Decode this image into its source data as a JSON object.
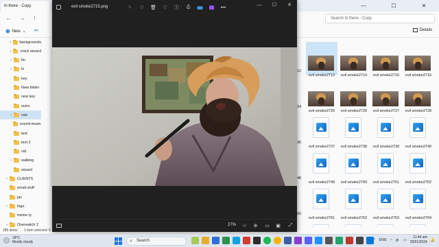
{
  "explorer": {
    "tab_title": "hi there - Copy",
    "window_controls": {
      "minimize": "—",
      "maximize": "☐",
      "close": "✕"
    },
    "search_placeholder": "Search hi there - Copy",
    "new_label": "New",
    "details_label": "Details",
    "sidebar": [
      {
        "label": "backgrounds",
        "chevron": "›"
      },
      {
        "label": "crack wizard",
        "chevron": "›"
      },
      {
        "label": "fin",
        "chevron": "›"
      },
      {
        "label": "fx",
        "chevron": "›"
      },
      {
        "label": "key",
        "chevron": ""
      },
      {
        "label": "New folder",
        "chevron": ""
      },
      {
        "label": "new key",
        "chevron": ""
      },
      {
        "label": "outro",
        "chevron": ""
      },
      {
        "label": "raw",
        "chevron": "›",
        "selected": true
      },
      {
        "label": "sound-music",
        "chevron": ""
      },
      {
        "label": "test",
        "chevron": ""
      },
      {
        "label": "text 2",
        "chevron": ""
      },
      {
        "label": "vid",
        "chevron": ""
      },
      {
        "label": "walking",
        "chevron": "›"
      },
      {
        "label": "wizard",
        "chevron": ""
      },
      {
        "label": "CLIENTS",
        "chevron": "›"
      },
      {
        "label": "email stuff",
        "chevron": ""
      },
      {
        "label": "jaz",
        "chevron": ""
      },
      {
        "label": "logo",
        "chevron": "›"
      },
      {
        "label": "meme ty",
        "chevron": ""
      },
      {
        "label": "Overwatch 2",
        "chevron": "›"
      }
    ],
    "status": {
      "items": "285 items",
      "selected": "1 item selected",
      "extra": "6"
    },
    "partial_numbers": [
      "12",
      "24",
      "36",
      "48",
      "60"
    ],
    "grid": [
      [
        {
          "name": "evil smoke2713",
          "type": "photo",
          "selected": true
        },
        {
          "name": "evil smoke2714",
          "type": "photo"
        },
        {
          "name": "evil smoke2715",
          "type": "photo"
        },
        {
          "name": "evil smoke2716",
          "type": "photo"
        }
      ],
      [
        {
          "name": "evil smoke2725",
          "type": "photo"
        },
        {
          "name": "evil smoke2726",
          "type": "photo"
        },
        {
          "name": "evil smoke2727",
          "type": "photo"
        },
        {
          "name": "evil smoke2728",
          "type": "photo"
        }
      ],
      [
        {
          "name": "evil smoke2737",
          "type": "file"
        },
        {
          "name": "evil smoke2738",
          "type": "file"
        },
        {
          "name": "evil smoke2739",
          "type": "file"
        },
        {
          "name": "evil smoke2740",
          "type": "file"
        }
      ],
      [
        {
          "name": "evil smoke2749",
          "type": "file"
        },
        {
          "name": "evil smoke2750",
          "type": "file"
        },
        {
          "name": "evil smoke2751",
          "type": "file"
        },
        {
          "name": "evil smoke2752",
          "type": "file"
        }
      ],
      [
        {
          "name": "evil smoke2761",
          "type": "file"
        },
        {
          "name": "evil smoke2762",
          "type": "file"
        },
        {
          "name": "evil smoke2763",
          "type": "file"
        },
        {
          "name": "evil smoke2764",
          "type": "file"
        }
      ],
      [
        {
          "name": "",
          "type": "file"
        },
        {
          "name": "",
          "type": "file"
        },
        {
          "name": "",
          "type": "file"
        },
        {
          "name": "",
          "type": "file"
        }
      ]
    ]
  },
  "viewer": {
    "filename": "evil smoke2715.png",
    "zoom": "27%",
    "window_controls": {
      "minimize": "—",
      "maximize": "☐",
      "close": "✕"
    },
    "toolbar_icons": [
      "edit-icon",
      "rotate-icon",
      "delete-icon",
      "favorite-icon",
      "info-icon",
      "print-icon",
      "cloud-icon",
      "ai-icon",
      "more-icon"
    ]
  },
  "taskbar": {
    "weather_temp": "18°C",
    "weather_desc": "Mostly cloudy",
    "search_placeholder": "Search",
    "language": "ENG",
    "time": "11:44 am",
    "date": "25/01/2024"
  },
  "colors": {
    "accent": "#0a6ed1",
    "viewer_bg": "#202020",
    "taskbar_bg": "#dfe6ef"
  }
}
